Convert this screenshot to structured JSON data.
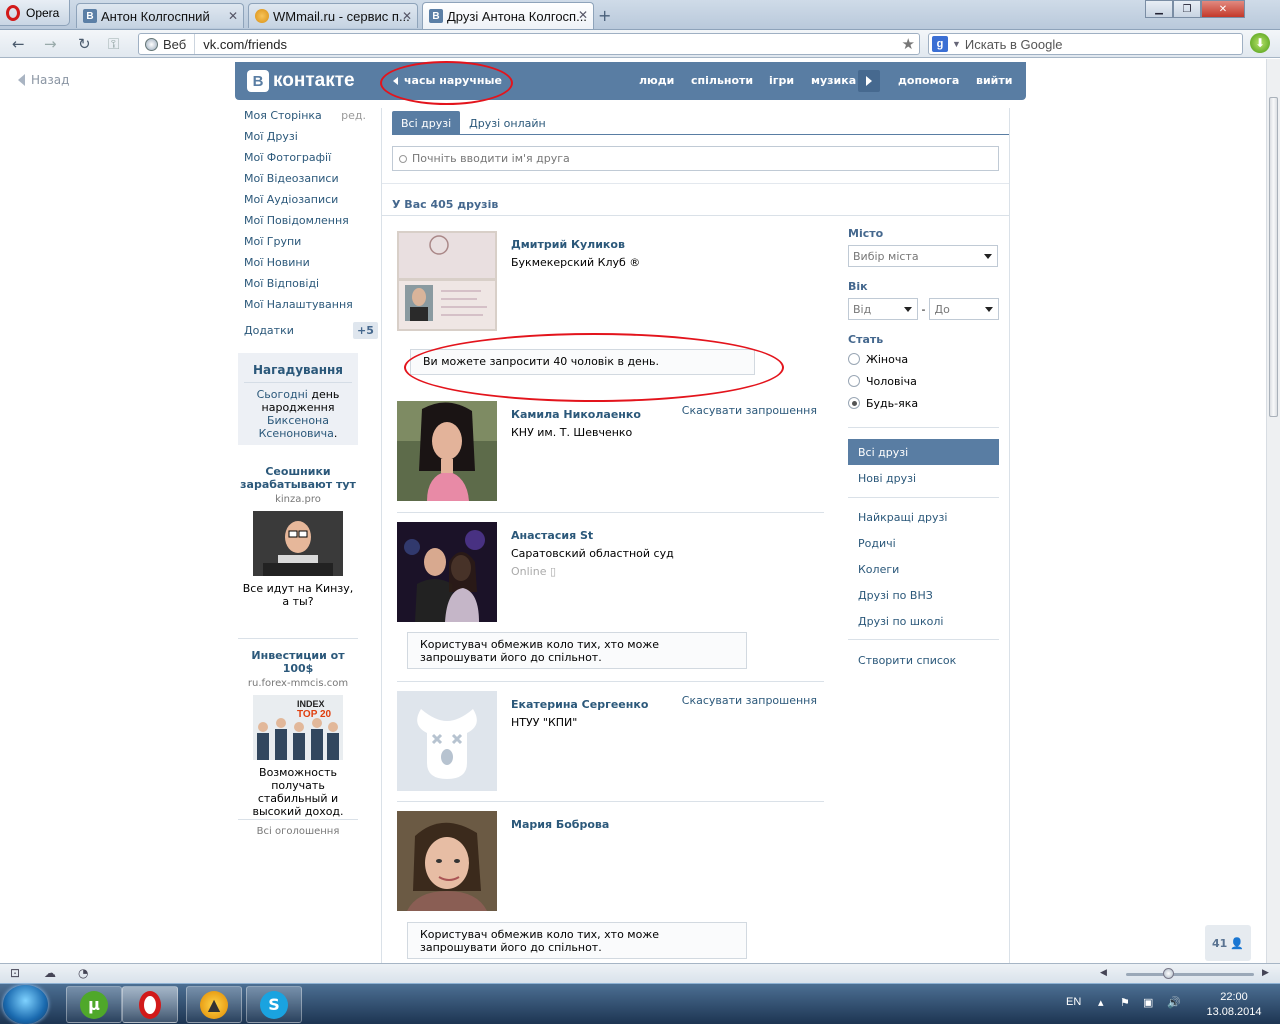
{
  "browser": {
    "menu_label": "Opera",
    "tabs": [
      {
        "title": "Антон Колгоспний",
        "favicon": "vk-icon"
      },
      {
        "title": "WMmail.ru - сервис п...",
        "favicon": "wmmail-icon"
      },
      {
        "title": "Друзі Антона Колгосп...",
        "favicon": "vk-icon",
        "active": true
      }
    ],
    "address_prefix": "Веб",
    "url": "vk.com/friends",
    "search_placeholder": "Искать в Google"
  },
  "vk": {
    "back_label": "Назад",
    "logo_text": "контакте",
    "logo_letter": "В",
    "promo_text": "часы наручные",
    "nav": [
      "люди",
      "спільноти",
      "ігри",
      "музика",
      "допомога",
      "вийти"
    ],
    "left_menu": [
      "Моя Сторінка",
      "Мої Друзі",
      "Мої Фотографії",
      "Мої Відеозаписи",
      "Мої Аудіозаписи",
      "Мої Повідомлення",
      "Мої Групи",
      "Мої Новини",
      "Мої Відповіді",
      "Мої Налаштування"
    ],
    "edit_label": "ред.",
    "addons_label": "Додатки",
    "addons_badge": "+5",
    "reminder": {
      "title": "Нагадування",
      "today": "Сьогодні",
      "text1": "день народження",
      "name": "Биксенона Ксеноновича",
      "dot": "."
    },
    "ads": [
      {
        "title": "Сеошники зарабатывают тут",
        "domain": "kinza.pro",
        "desc": "Все идут на Кинзу, а ты?"
      },
      {
        "title": "Инвестиции от 100$",
        "domain": "ru.forex-mmcis.com",
        "desc": "Возможность получать стабильный и высокий доход.",
        "img_text1": "INDEX",
        "img_text2": "TOP 20"
      }
    ],
    "all_ads": "Всі оголошення",
    "tabs": [
      "Всі друзі",
      "Друзі онлайн"
    ],
    "search_placeholder": "Почніть вводити ім'я друга",
    "friends_count": "У Вас 405 друзів",
    "friends": [
      {
        "name": "Дмитрий Куликов",
        "sub": "Букмекерский Клуб ®",
        "action": "",
        "online": ""
      },
      {
        "name": "Камила Николаенко",
        "sub": "КНУ им. Т. Шевченко",
        "action": "Скасувати запрошення",
        "online": ""
      },
      {
        "name": "Анастасия St",
        "sub": "Саратовский областной суд",
        "action": "",
        "online": "Online"
      },
      {
        "name": "Екатерина Сергеенко",
        "sub": "НТУУ \"КПИ\"",
        "action": "Скасувати запрошення",
        "online": ""
      },
      {
        "name": "Мария Боброва",
        "sub": "",
        "action": "",
        "online": ""
      }
    ],
    "notice_invite": "Ви можете запросити 40 чоловік в день.",
    "notice_restricted": "Користувач обмежив коло тих, хто може запрошувати його до спільнот.",
    "filters": {
      "city_label": "Місто",
      "city_value": "Вибір міста",
      "age_label": "Вік",
      "age_from": "Від",
      "age_dash": "-",
      "age_to": "До",
      "sex_label": "Стать",
      "sex_options": [
        "Жіноча",
        "Чоловіча",
        "Будь-яка"
      ],
      "sex_selected": "Будь-яка"
    },
    "right_menu_a": [
      "Всі друзі",
      "Нові друзі"
    ],
    "right_menu_b": [
      "Найкращі друзі",
      "Родичі",
      "Колеги",
      "Друзі по ВНЗ",
      "Друзі по школі"
    ],
    "create_list": "Створити список",
    "counter": "41"
  },
  "taskbar": {
    "lang": "EN",
    "time": "22:00",
    "date": "13.08.2014"
  },
  "colors": {
    "vk_blue": "#597da3",
    "link": "#2b587a",
    "annotation_red": "#e3141c"
  }
}
